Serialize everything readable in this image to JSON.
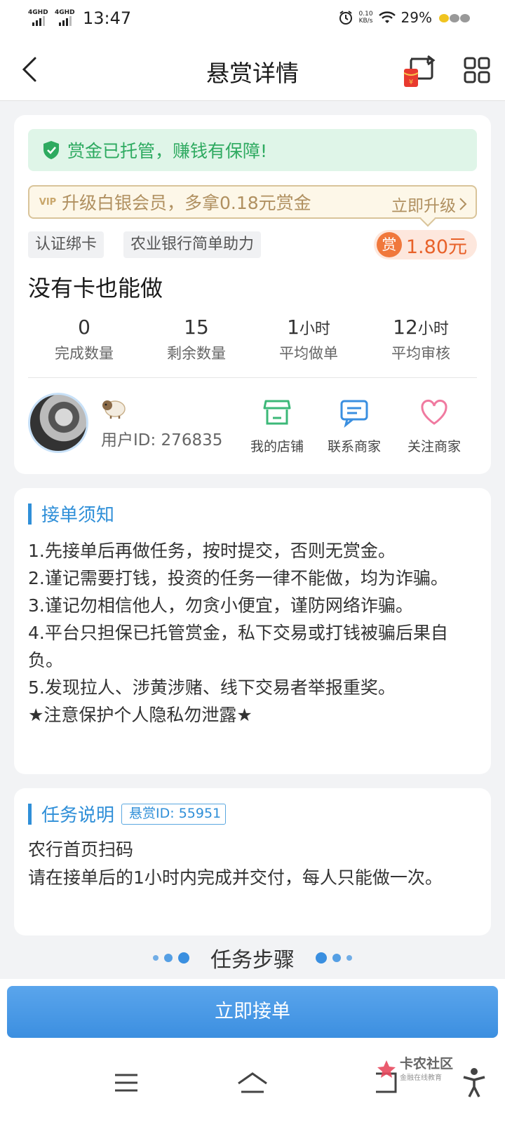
{
  "status_bar": {
    "net1": "4GHD",
    "net2": "4GHD",
    "time": "13:47",
    "speed_value": "0.10",
    "speed_unit": "KB/s",
    "battery": "29%"
  },
  "nav": {
    "title": "悬赏详情",
    "icons": [
      "back-arrow-icon",
      "red-packet-share-icon",
      "grid-menu-icon"
    ]
  },
  "task_card": {
    "escrow_text": "赏金已托管，赚钱有保障!",
    "vip_badge": "VIP",
    "vip_text": "升级白银会员，多拿0.18元赏金",
    "vip_action": "立即升级",
    "tags": [
      "认证绑卡",
      "农业银行简单助力"
    ],
    "reward_icon_char": "赏",
    "reward_amount": "1.80元",
    "title": "没有卡也能做",
    "stats": [
      {
        "value": "0",
        "unit": "",
        "label": "完成数量"
      },
      {
        "value": "15",
        "unit": "",
        "label": "剩余数量"
      },
      {
        "value": "1",
        "unit": "小时",
        "label": "平均做单"
      },
      {
        "value": "12",
        "unit": "小时",
        "label": "平均审核"
      }
    ],
    "user_id": "用户ID: 276835",
    "actions": [
      {
        "label": "我的店铺",
        "icon": "store-icon",
        "color": "#3cb878"
      },
      {
        "label": "联系商家",
        "icon": "chat-icon",
        "color": "#3a8fe0"
      },
      {
        "label": "关注商家",
        "icon": "heart-icon",
        "color": "#f07aa0"
      }
    ]
  },
  "notice": {
    "heading": "接单须知",
    "lines": [
      "1.先接单后再做任务，按时提交，否则无赏金。",
      "2.谨记需要打钱，投资的任务一律不能做，均为诈骗。",
      "3.谨记勿相信他人，勿贪小便宜，谨防网络诈骗。",
      "4.平台只担保已托管赏金，私下交易或打钱被骗后果自负。",
      "5.发现拉人、涉黄涉赌、线下交易者举报重奖。",
      "★注意保护个人隐私勿泄露★"
    ]
  },
  "description": {
    "heading": "任务说明",
    "id_tag": "悬赏ID: 55951",
    "lines": [
      "农行首页扫码",
      "请在接单后的1小时内完成并交付，每人只能做一次。"
    ]
  },
  "steps_heading": "任务步骤",
  "accept_button": "立即接单",
  "watermark": {
    "title": "卡农社区",
    "subtitle": "金融在线教育"
  },
  "colors": {
    "primary": "#3a8fe0",
    "green": "#2eaa60",
    "reward": "#e8622a"
  }
}
